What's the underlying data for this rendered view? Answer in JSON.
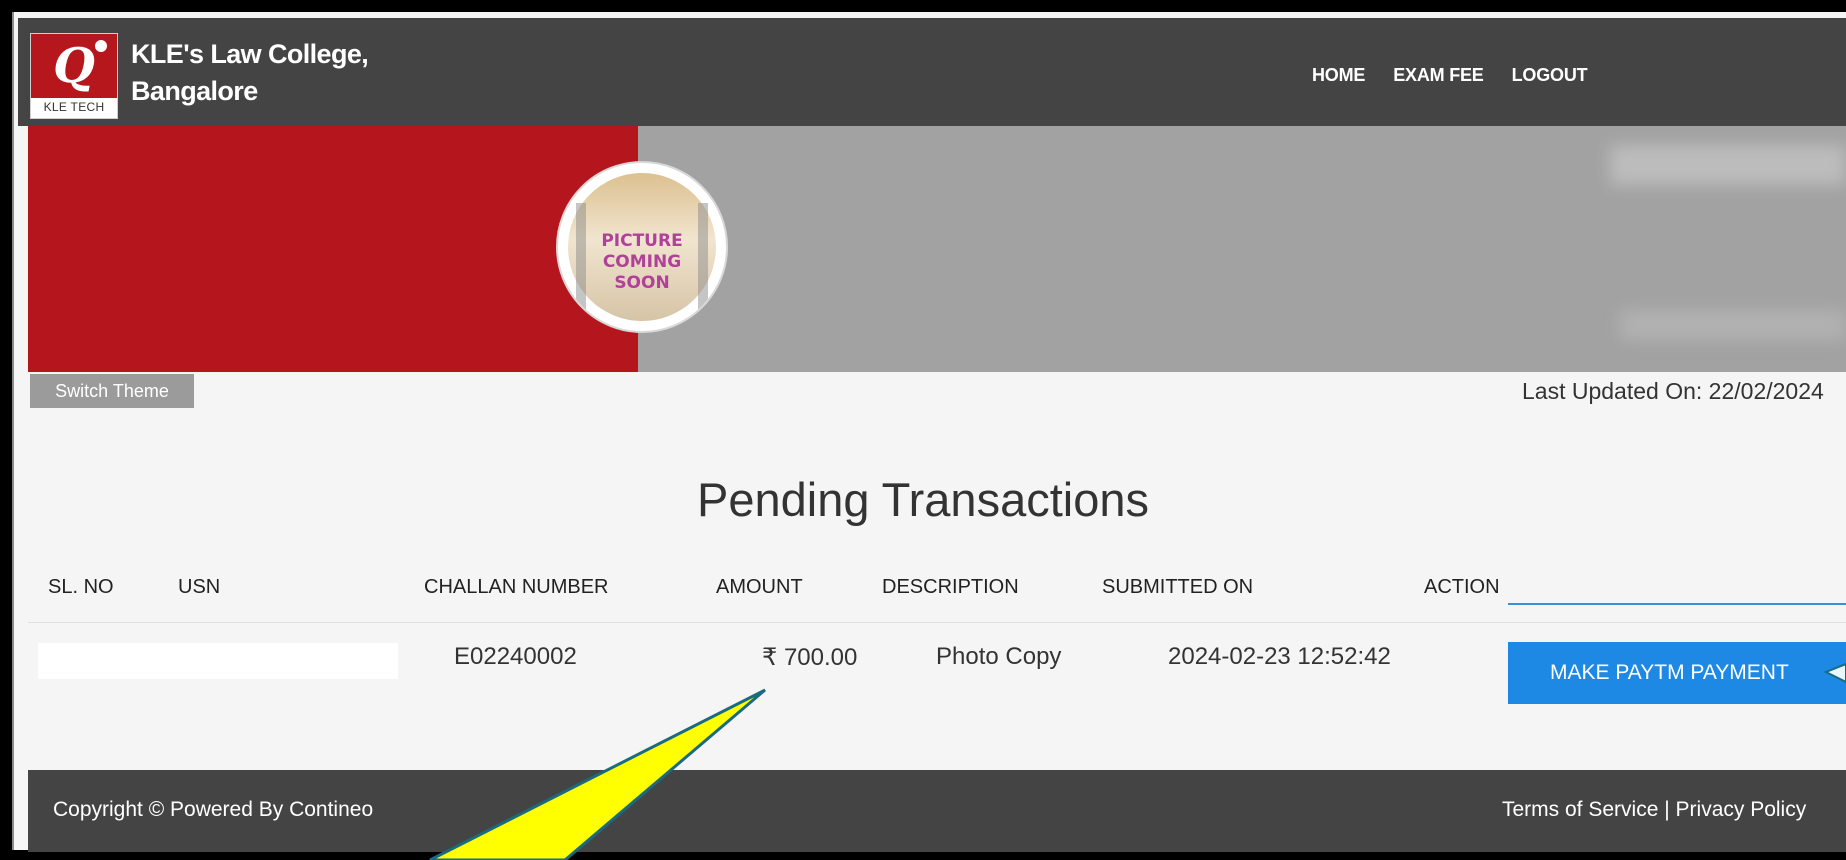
{
  "header": {
    "logo_text": "KLE TECH",
    "college_line1": "KLE's Law College,",
    "college_line2": "Bangalore",
    "nav": [
      {
        "label": "HOME"
      },
      {
        "label": "EXAM FEE"
      },
      {
        "label": "LOGOUT"
      }
    ]
  },
  "banner": {
    "avatar_text": [
      "PICTURE",
      "COMING",
      "SOON"
    ]
  },
  "switch_theme_label": "Switch Theme",
  "last_updated": "Last Updated On: 22/02/2024",
  "page_title": "Pending Transactions",
  "table": {
    "columns": [
      "SL. NO",
      "USN",
      "CHALLAN NUMBER",
      "AMOUNT",
      "DESCRIPTION",
      "SUBMITTED ON",
      "ACTION"
    ],
    "rows": [
      {
        "challan_number": "E02240002",
        "amount": "₹ 700.00",
        "description": "Photo Copy",
        "submitted_on": "2024-02-23 12:52:42",
        "action_label": "MAKE PAYTM PAYMENT"
      }
    ]
  },
  "footer": {
    "copyright": "Copyright © Powered By Contineo",
    "terms": "Terms of Service",
    "separator": "|",
    "privacy": "Privacy Policy"
  },
  "colors": {
    "header_bg": "#444444",
    "banner_red": "#b5161d",
    "banner_gray": "#a2a2a2",
    "button_blue": "#1e88e5",
    "annotation_yellow": "#ffff00",
    "annotation_outline": "#1a6b80"
  }
}
